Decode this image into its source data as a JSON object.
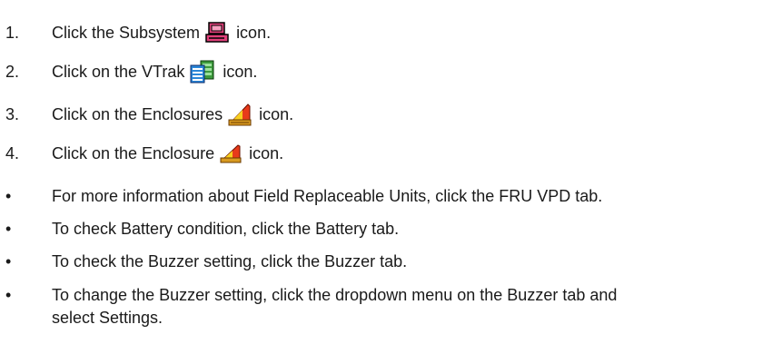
{
  "steps": [
    {
      "number": "1.",
      "before": "Click the Subsystem",
      "after": "icon.",
      "icon": "subsystem-icon"
    },
    {
      "number": "2.",
      "before": "Click on the VTrak",
      "after": "icon.",
      "icon": "vtrak-icon"
    },
    {
      "number": "3.",
      "before": "Click on the Enclosures",
      "after": "icon.",
      "icon": "enclosures-icon"
    },
    {
      "number": "4.",
      "before": "Click on the Enclosure",
      "after": "icon.",
      "icon": "enclosure-icon"
    }
  ],
  "bullets": [
    {
      "marker": "•",
      "text": "For more information about Field Replaceable Units, click the FRU VPD tab."
    },
    {
      "marker": "•",
      "text": "To check Battery condition, click the Battery tab."
    },
    {
      "marker": "•",
      "text": "To check the Buzzer setting, click the Buzzer tab."
    },
    {
      "marker": "•",
      "text": "To change the Buzzer setting, click the dropdown menu on the Buzzer tab and select Settings."
    }
  ],
  "colors": {
    "subsystem_icon": "#e0407a",
    "vtrak_icon": "#3c9a3c",
    "enclosure_icon": "#e8a020"
  }
}
